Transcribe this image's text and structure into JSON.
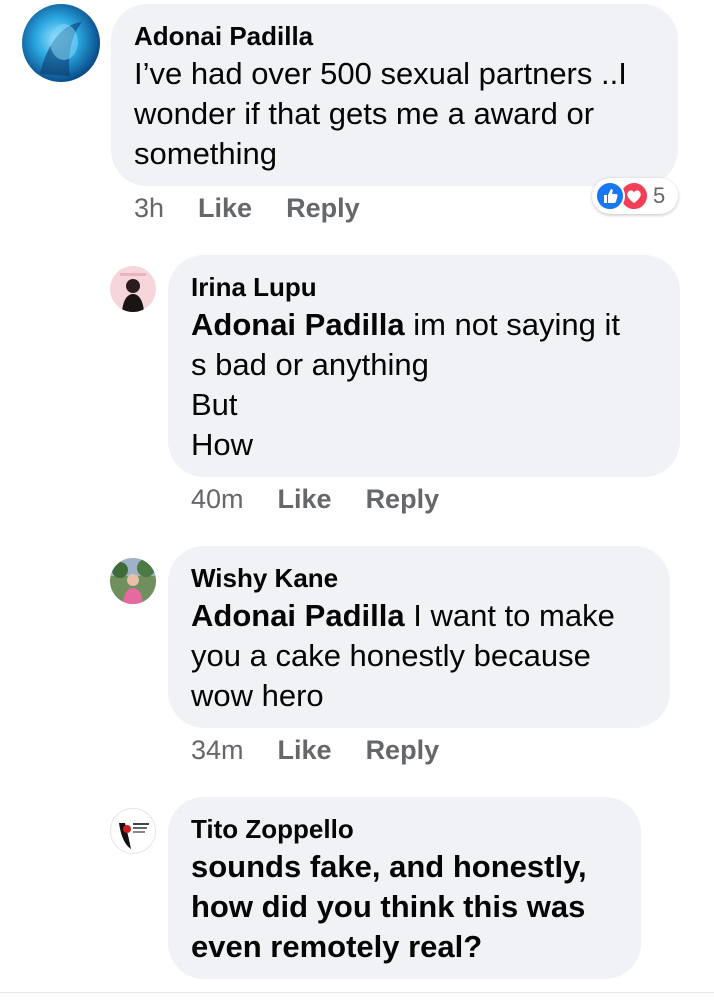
{
  "comments": [
    {
      "author": "Adonai Padilla",
      "text": "I’ve had over 500 sexual partners ..I wonder if that gets me a award or something",
      "time": "3h",
      "like": "Like",
      "reply": "Reply",
      "reaction_count": "5",
      "reactions": [
        "like-icon",
        "love-icon"
      ]
    },
    {
      "author": "Irina Lupu",
      "mention": "Adonai Padilla",
      "text_lines": [
        " im not saying it",
        "s bad or anything",
        "But",
        "How"
      ],
      "time": "40m",
      "like": "Like",
      "reply": "Reply"
    },
    {
      "author": "Wishy Kane",
      "mention": "Adonai Padilla",
      "text_lines": [
        " I want to make",
        "you a cake honestly because",
        "wow hero"
      ],
      "time": "34m",
      "like": "Like",
      "reply": "Reply"
    },
    {
      "author": "Tito Zoppello",
      "text_lines": [
        "sounds fake, and honestly,",
        "how did you think this was",
        "even remotely real?"
      ]
    }
  ],
  "colors": {
    "bubble": "#f0f2f5",
    "meta_text": "#65676b",
    "like_blue": "#1877f2",
    "love_red": "#f33e58"
  }
}
